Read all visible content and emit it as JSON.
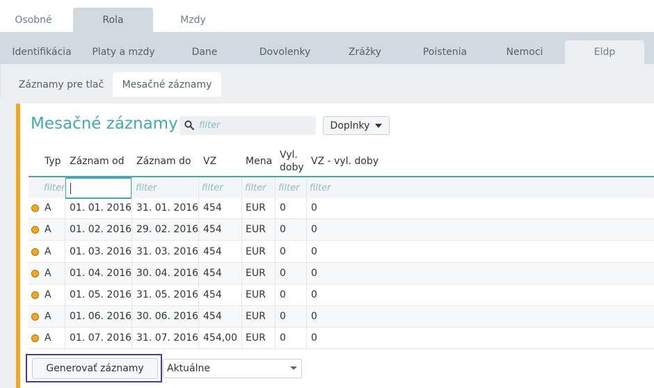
{
  "tabs_level1": [
    {
      "label": "Osobné",
      "active": false
    },
    {
      "label": "Rola",
      "active": true
    },
    {
      "label": "Mzdy",
      "active": false
    }
  ],
  "tabs_level2": [
    {
      "label": "Identifikácia",
      "active": false
    },
    {
      "label": "Platy a mzdy",
      "active": false
    },
    {
      "label": "Dane",
      "active": false
    },
    {
      "label": "Dovolenky",
      "active": false
    },
    {
      "label": "Zrážky",
      "active": false
    },
    {
      "label": "Poistenia",
      "active": false
    },
    {
      "label": "Nemoci",
      "active": false
    },
    {
      "label": "Eldp",
      "active": true
    }
  ],
  "tabs_level3": [
    {
      "label": "Záznamy pre tlač",
      "active": false
    },
    {
      "label": "Mesačné záznamy",
      "active": true
    }
  ],
  "panel": {
    "title": "Mesačné záznamy",
    "search_placeholder": "filter",
    "doplnky_label": "Doplnky"
  },
  "table": {
    "headers": {
      "typ": "Typ",
      "od": "Záznam od",
      "do": "Záznam do",
      "vz": "VZ",
      "mena": "Mena",
      "vyl1": "Vyl.",
      "vyl2": "doby",
      "vzvyl": "VZ - vyl. doby"
    },
    "filter_placeholder": "filter",
    "rows": [
      {
        "typ": "A",
        "od": "01. 01. 2016",
        "do": "31. 01. 2016",
        "vz": "454",
        "mena": "EUR",
        "vyl": "0",
        "vzvyl": "0"
      },
      {
        "typ": "A",
        "od": "01. 02. 2016",
        "do": "29. 02. 2016",
        "vz": "454",
        "mena": "EUR",
        "vyl": "0",
        "vzvyl": "0"
      },
      {
        "typ": "A",
        "od": "01. 03. 2016",
        "do": "31. 03. 2016",
        "vz": "454",
        "mena": "EUR",
        "vyl": "0",
        "vzvyl": "0"
      },
      {
        "typ": "A",
        "od": "01. 04. 2016",
        "do": "30. 04. 2016",
        "vz": "454",
        "mena": "EUR",
        "vyl": "0",
        "vzvyl": "0"
      },
      {
        "typ": "A",
        "od": "01. 05. 2016",
        "do": "31. 05. 2016",
        "vz": "454",
        "mena": "EUR",
        "vyl": "0",
        "vzvyl": "0"
      },
      {
        "typ": "A",
        "od": "01. 06. 2016",
        "do": "30. 06. 2016",
        "vz": "454",
        "mena": "EUR",
        "vyl": "0",
        "vzvyl": "0"
      },
      {
        "typ": "A",
        "od": "01. 07. 2016",
        "do": "31. 07. 2016",
        "vz": "454,00",
        "mena": "EUR",
        "vyl": "0",
        "vzvyl": "0"
      }
    ]
  },
  "footer": {
    "generate_label": "Generovať záznamy",
    "select_value": "Aktuálne"
  },
  "colors": {
    "accent": "#3fa9b5",
    "status_orange": "#f5a623",
    "highlight_frame": "#3b3fa8"
  },
  "icons": {
    "search": "search-icon",
    "dropdown": "chevron-down-icon",
    "status": "status-dot-icon"
  }
}
